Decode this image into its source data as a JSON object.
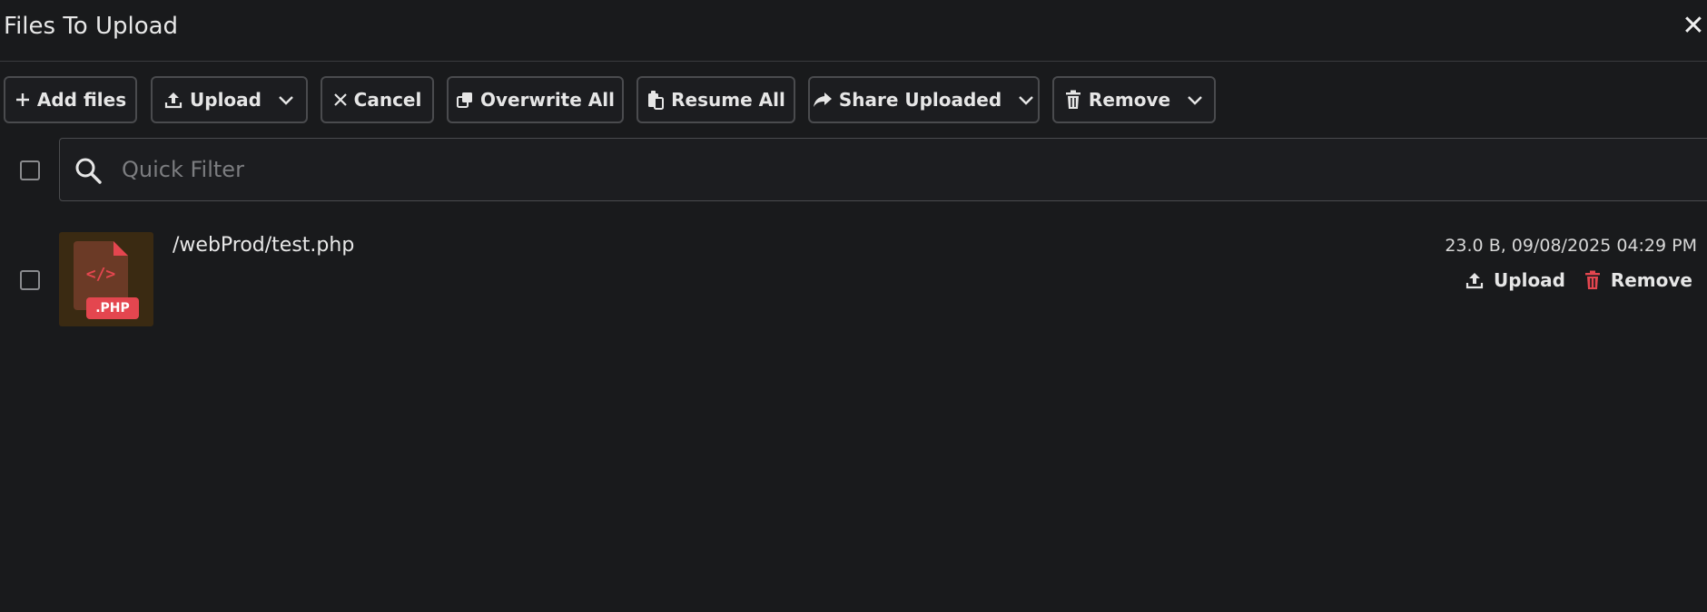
{
  "dialog": {
    "title": "Files To Upload",
    "close_glyph": "✕"
  },
  "toolbar": {
    "add_files": "Add files",
    "upload": "Upload",
    "cancel": "Cancel",
    "overwrite_all": "Overwrite All",
    "resume_all": "Resume All",
    "share_uploaded": "Share Uploaded",
    "remove": "Remove"
  },
  "filter": {
    "placeholder": "Quick Filter",
    "value": ""
  },
  "files": [
    {
      "path": "/webProd/test.php",
      "meta": "23.0 B, 09/08/2025 04:29 PM",
      "badge": ".PHP",
      "code_glyph": "</>",
      "upload_label": "Upload",
      "remove_label": "Remove"
    }
  ],
  "colors": {
    "background": "#191a1c",
    "danger": "#e4464f",
    "border": "#4a4b4e"
  }
}
